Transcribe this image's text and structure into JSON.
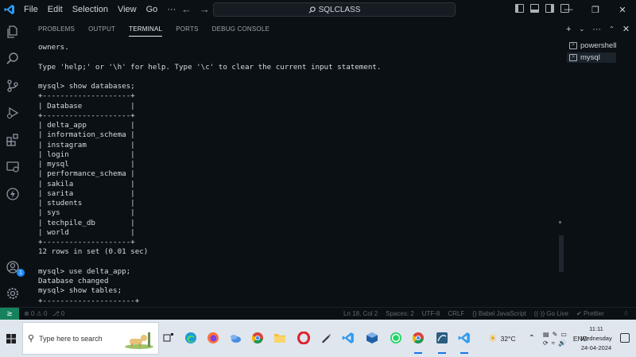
{
  "titlebar": {
    "menu": [
      "File",
      "Edit",
      "Selection",
      "View",
      "Go",
      "···"
    ],
    "search_text": "SQLCLASS"
  },
  "panel": {
    "tabs": [
      "PROBLEMS",
      "OUTPUT",
      "TERMINAL",
      "PORTS",
      "DEBUG CONSOLE"
    ],
    "active_tab": "TERMINAL",
    "terminal_lines": [
      "owners.",
      "",
      "Type 'help;' or '\\h' for help. Type '\\c' to clear the current input statement.",
      "",
      "mysql> show databases;",
      "+--------------------+",
      "| Database           |",
      "+--------------------+",
      "| delta_app          |",
      "| information_schema |",
      "| instagram          |",
      "| login              |",
      "| mysql              |",
      "| performance_schema |",
      "| sakila             |",
      "| sarita             |",
      "| students           |",
      "| sys                |",
      "| techpile_db        |",
      "| world              |",
      "+--------------------+",
      "12 rows in set (0.01 sec)",
      "",
      "mysql> use delta_app;",
      "Database changed",
      "mysql> show tables;",
      "+---------------------+"
    ]
  },
  "terminals": {
    "items": [
      "powershell",
      "mysql"
    ],
    "active": "mysql"
  },
  "statusbar": {
    "problems": "⊗ 0 ⚠ 0",
    "ports": "⎇ 0",
    "items": [
      "Ln 18, Col 2",
      "Spaces: 2",
      "UTF-8",
      "CRLF",
      "{} Babel JavaScript",
      "((·)) Go Live",
      "✔ Prettier"
    ]
  },
  "taskbar": {
    "search_placeholder": "Type here to search",
    "weather": "32°C",
    "language": "ENG",
    "time": "11:11",
    "day": "Wednesday",
    "date": "24-04-2024"
  },
  "accounts_badge": "1",
  "colors": {
    "background": "#0b1015",
    "remote_indicator": "#16825d",
    "taskbar": "#dfe6ee",
    "accent": "#1a8cff"
  }
}
